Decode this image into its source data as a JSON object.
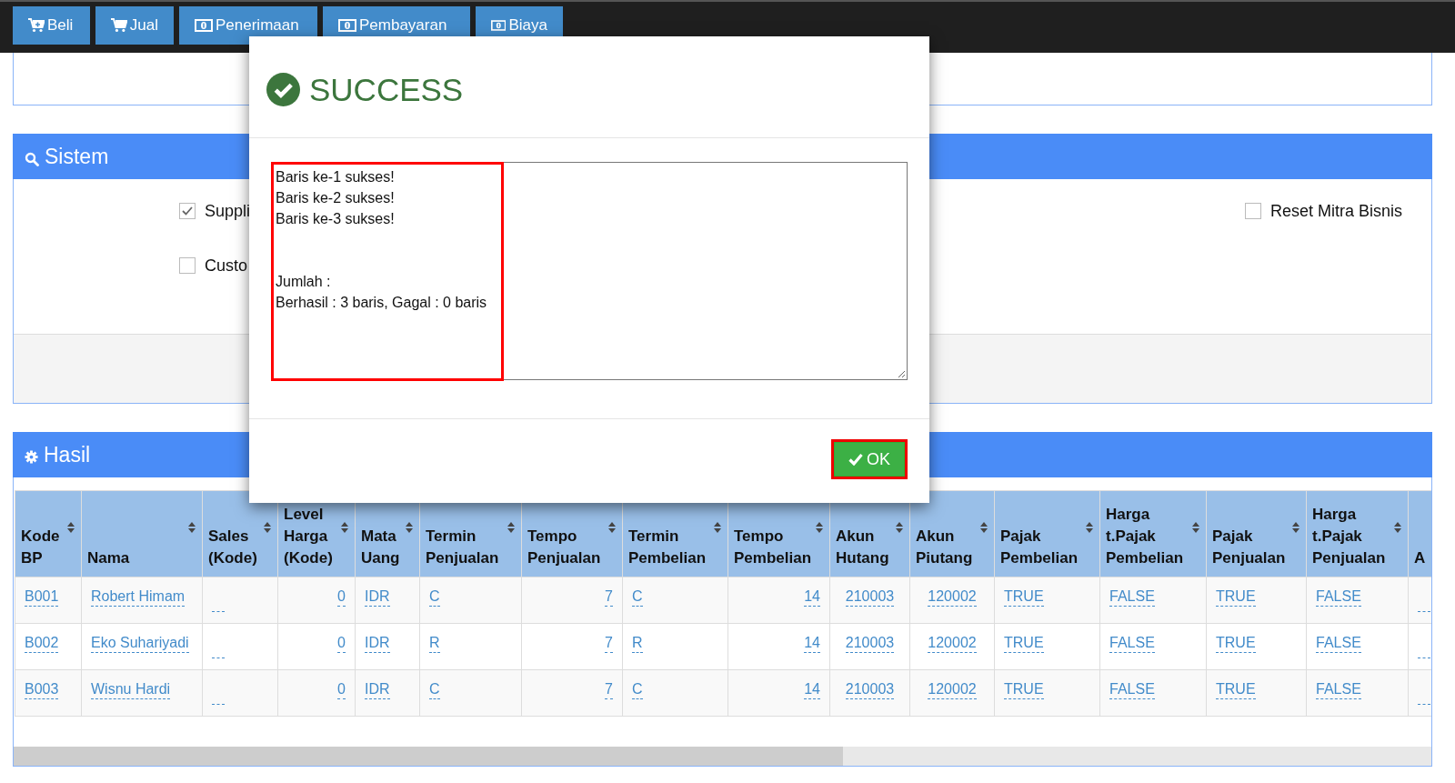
{
  "nav": [
    {
      "label": "Beli"
    },
    {
      "label": "Jual"
    },
    {
      "label": "Penerimaan"
    },
    {
      "label": "Pembayaran"
    },
    {
      "label": "Biaya"
    }
  ],
  "sistem": {
    "title": "Sistem",
    "options": [
      {
        "label": "Suppli",
        "checked": true
      },
      {
        "label": "Custo",
        "checked": false
      },
      {
        "label": "Reset Mitra Bisnis",
        "checked": false
      }
    ]
  },
  "hasil": {
    "title": "Hasil",
    "table": {
      "columns": [
        {
          "label": "Kode\nBP",
          "kind": "text"
        },
        {
          "label": "Nama",
          "kind": "text"
        },
        {
          "label": "Sales\n(Kode)",
          "kind": "blank"
        },
        {
          "label": "Level\nHarga\n(Kode)",
          "kind": "number"
        },
        {
          "label": "Mata\nUang",
          "kind": "text"
        },
        {
          "label": "Termin\nPenjualan",
          "kind": "text"
        },
        {
          "label": "Tempo\nPenjualan",
          "kind": "number"
        },
        {
          "label": "Termin\nPembelian",
          "kind": "text"
        },
        {
          "label": "Tempo\nPembelian",
          "kind": "number"
        },
        {
          "label": "Akun\nHutang",
          "kind": "code"
        },
        {
          "label": "Akun\nPiutang",
          "kind": "code"
        },
        {
          "label": "Pajak\nPembelian",
          "kind": "text"
        },
        {
          "label": "Harga\nt.Pajak\nPembelian",
          "kind": "text"
        },
        {
          "label": "Pajak\nPenjualan",
          "kind": "text"
        },
        {
          "label": "Harga\nt.Pajak\nPenjualan",
          "kind": "text"
        },
        {
          "label": "A",
          "kind": "blank"
        }
      ],
      "rows": [
        {
          "cells": [
            "B001",
            "Robert Himam",
            "",
            "0",
            "IDR",
            "C",
            "7",
            "C",
            "14",
            "210003",
            "120002",
            "TRUE",
            "FALSE",
            "TRUE",
            "FALSE",
            ""
          ]
        },
        {
          "cells": [
            "B002",
            "Eko Suhariyadi",
            "",
            "0",
            "IDR",
            "R",
            "7",
            "R",
            "14",
            "210003",
            "120002",
            "TRUE",
            "FALSE",
            "TRUE",
            "FALSE",
            ""
          ]
        },
        {
          "cells": [
            "B003",
            "Wisnu Hardi",
            "",
            "0",
            "IDR",
            "C",
            "7",
            "C",
            "14",
            "210003",
            "120002",
            "TRUE",
            "FALSE",
            "TRUE",
            "FALSE",
            ""
          ]
        }
      ]
    }
  },
  "dialog": {
    "title": "SUCCESS",
    "message": "Baris ke-1 sukses!\nBaris ke-2 sukses!\nBaris ke-3 sukses!\n\n\nJumlah :\nBerhasil : 3 baris, Gagal : 0 baris",
    "ok_button": "OK"
  }
}
